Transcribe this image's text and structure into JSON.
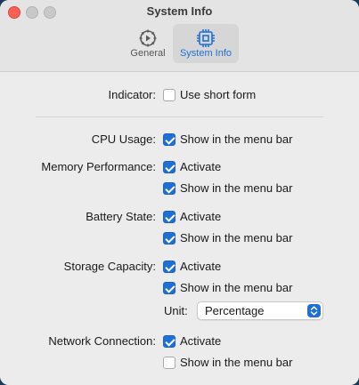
{
  "window": {
    "title": "System Info"
  },
  "toolbar": {
    "items": [
      {
        "label": "General",
        "icon": "gear-play-icon",
        "selected": false
      },
      {
        "label": "System Info",
        "icon": "cpu-chip-icon",
        "selected": true
      }
    ]
  },
  "settings": {
    "indicator": {
      "label": "Indicator:",
      "option": "Use short form",
      "checked": false
    },
    "cpu_usage": {
      "label": "CPU Usage:",
      "option": "Show in the menu bar",
      "checked": true
    },
    "memory_performance": {
      "label": "Memory Performance:",
      "activate": {
        "option": "Activate",
        "checked": true
      },
      "menu_bar": {
        "option": "Show in the menu bar",
        "checked": true
      }
    },
    "battery_state": {
      "label": "Battery State:",
      "activate": {
        "option": "Activate",
        "checked": true
      },
      "menu_bar": {
        "option": "Show in the menu bar",
        "checked": true
      }
    },
    "storage_capacity": {
      "label": "Storage Capacity:",
      "activate": {
        "option": "Activate",
        "checked": true
      },
      "menu_bar": {
        "option": "Show in the menu bar",
        "checked": true
      },
      "unit": {
        "label": "Unit:",
        "value": "Percentage"
      }
    },
    "network_connection": {
      "label": "Network Connection:",
      "activate": {
        "option": "Activate",
        "checked": true
      },
      "menu_bar": {
        "option": "Show in the menu bar",
        "checked": false
      }
    }
  },
  "colors": {
    "accent": "#1f6fd8",
    "close": "#ff5f57",
    "inactive_traffic": "#c8c8c8"
  }
}
